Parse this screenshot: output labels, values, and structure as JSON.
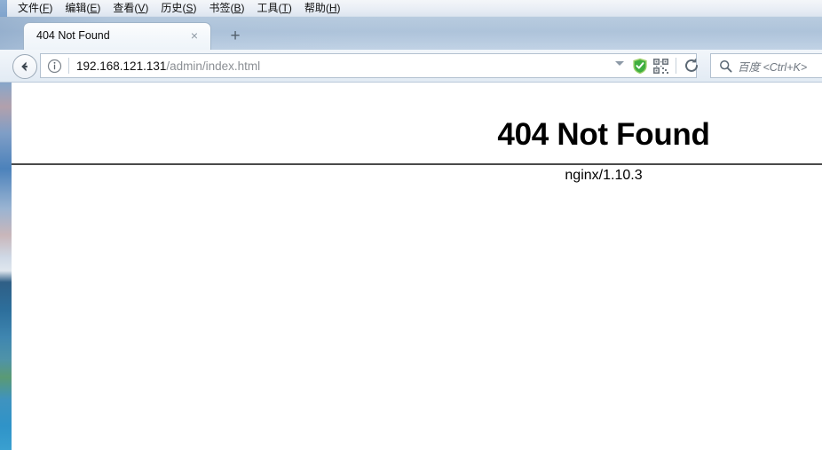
{
  "menu": {
    "items": [
      {
        "label": "文件",
        "accel": "F"
      },
      {
        "label": "编辑",
        "accel": "E"
      },
      {
        "label": "查看",
        "accel": "V"
      },
      {
        "label": "历史",
        "accel": "S"
      },
      {
        "label": "书签",
        "accel": "B"
      },
      {
        "label": "工具",
        "accel": "T"
      },
      {
        "label": "帮助",
        "accel": "H"
      }
    ]
  },
  "tabs": {
    "active": {
      "title": "404 Not Found",
      "close_label": "×"
    },
    "new_tab_label": "+"
  },
  "toolbar": {
    "back_icon": "back-arrow-icon",
    "identity_icon": "info-icon",
    "url": {
      "host": "192.168.121.131",
      "path": "/admin/index.html"
    },
    "dropdown_icon": "chevron-down-icon",
    "shield_icon": "green-shield-check-icon",
    "qr_icon": "qr-code-icon",
    "reload_icon": "reload-icon",
    "search": {
      "icon": "search-icon",
      "placeholder": "百度 <Ctrl+K>"
    }
  },
  "page": {
    "heading": "404 Not Found",
    "server_signature": "nginx/1.10.3"
  },
  "colors": {
    "shield_green": "#3fae3f",
    "chrome_blue": "#aec3da",
    "url_host_text": "#111111",
    "url_path_text": "#8b8f94",
    "page_text": "#000000"
  }
}
